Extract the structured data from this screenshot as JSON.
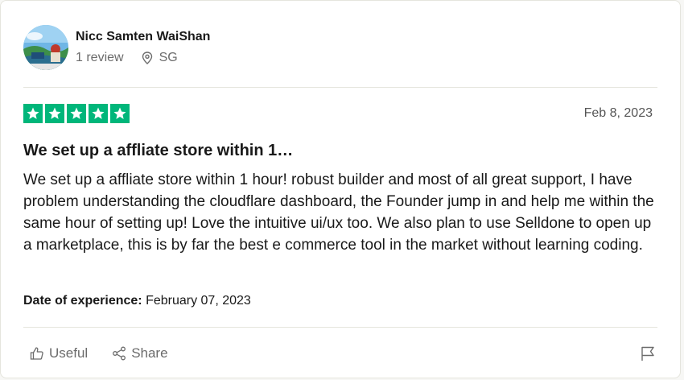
{
  "reviewer": {
    "name": "Nicc Samten WaiShan",
    "reviews": "1 review",
    "location": "SG"
  },
  "review": {
    "rating": 5,
    "max_rating": 5,
    "date": "Feb 8, 2023",
    "title": "We set up a affliate store within 1…",
    "body": "We set up a affliate store within 1 hour! robust builder and most of all great support, I have problem understanding the cloudflare dashboard, the Founder jump in and help me within the same hour of setting up! Love the intuitive ui/ux too. We also plan to use Selldone to open up a marketplace, this is by far the best e commerce tool in the market without learning coding.",
    "experience_label": "Date of experience:",
    "experience_date": "February 07, 2023"
  },
  "actions": {
    "useful_label": "Useful",
    "share_label": "Share"
  },
  "colors": {
    "star_green": "#00b67a",
    "muted_text": "#6b6b6b"
  },
  "icons": [
    "avatar",
    "location-pin-icon",
    "star-icon",
    "thumbs-up-icon",
    "share-icon",
    "flag-icon"
  ]
}
